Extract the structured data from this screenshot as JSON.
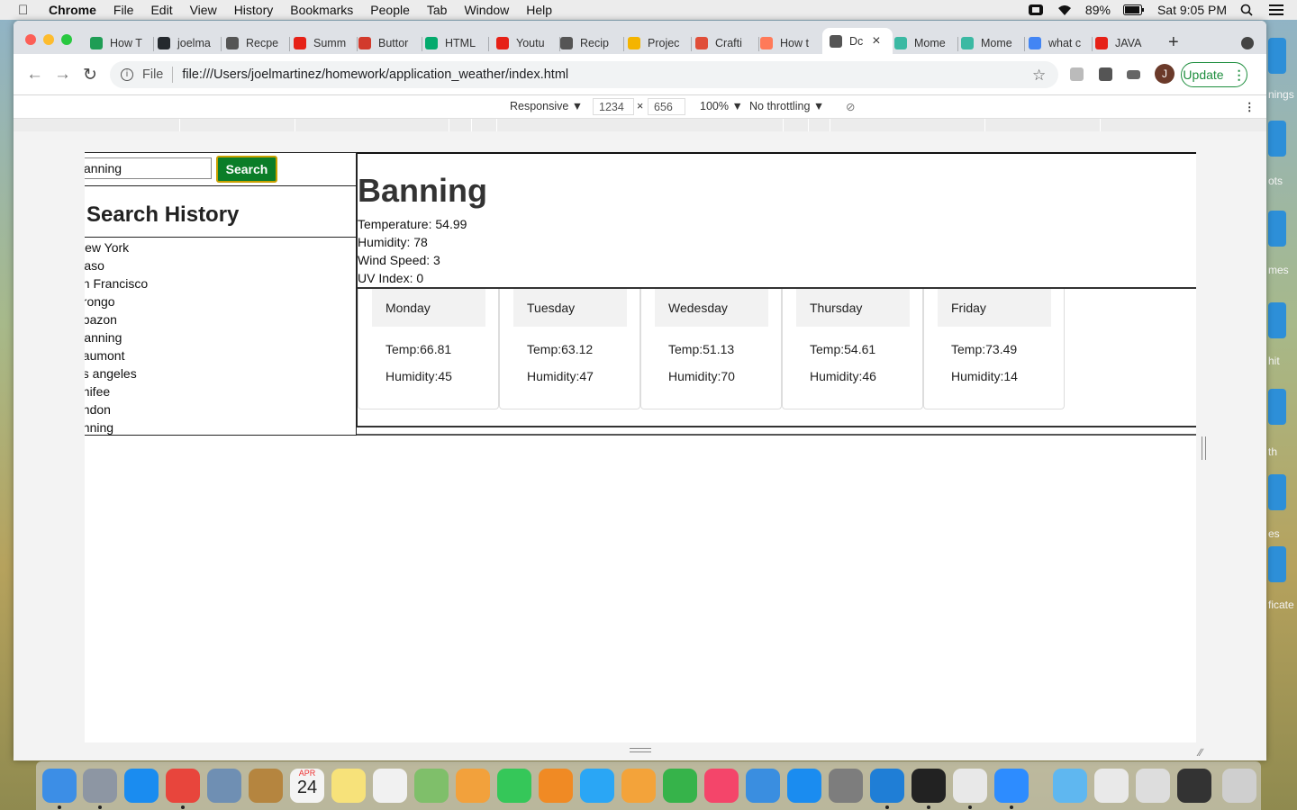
{
  "menubar": {
    "app": "Chrome",
    "items": [
      "File",
      "Edit",
      "View",
      "History",
      "Bookmarks",
      "People",
      "Tab",
      "Window",
      "Help"
    ],
    "battery": "89%",
    "clock": "Sat 9:05 PM"
  },
  "tabs": [
    {
      "label": "How T",
      "color": "#1f9d55"
    },
    {
      "label": "joelma",
      "color": "#24292e"
    },
    {
      "label": "Recpe",
      "color": "#555555"
    },
    {
      "label": "Summ",
      "color": "#e62117"
    },
    {
      "label": "Buttor",
      "color": "#d23a2c"
    },
    {
      "label": "HTML",
      "color": "#04aa6d"
    },
    {
      "label": "Youtu",
      "color": "#e62117"
    },
    {
      "label": "Recip",
      "color": "#555555"
    },
    {
      "label": "Projec",
      "color": "#f4b400"
    },
    {
      "label": "Crafti",
      "color": "#e04e39"
    },
    {
      "label": "How t",
      "color": "#ff7a59"
    },
    {
      "label": "Dc",
      "color": "#555555",
      "active": true
    },
    {
      "label": "Mome",
      "color": "#3bb9a3"
    },
    {
      "label": "Mome",
      "color": "#3bb9a3"
    },
    {
      "label": "what c",
      "color": "#4285f4"
    },
    {
      "label": "JAVA",
      "color": "#e62117"
    }
  ],
  "omnibox": {
    "scheme": "File",
    "url": "file:///Users/joelmartinez/homework/application_weather/index.html"
  },
  "profile_initial": "J",
  "update_label": "Update",
  "devtools": {
    "device": "Responsive ▼",
    "width": "1234",
    "times": "×",
    "height": "656",
    "zoom": "100% ▼",
    "throttling": "No throttling ▼"
  },
  "page": {
    "search_value": "anning",
    "search_button": "Search",
    "history_title": "Search History",
    "history": [
      "New York",
      " Paso",
      "an Francisco",
      "orongo",
      "abazon",
      "Banning",
      "eaumont",
      "os angeles",
      "enifee",
      "ondon",
      "anning"
    ],
    "city": "Banning",
    "temperature": "Temperature: 54.99",
    "humidity": "Humidity: 78",
    "wind": "Wind Speed: 3",
    "uv": "UV Index: 0",
    "forecast": [
      {
        "day": "Monday",
        "temp": "Temp:66.81",
        "humidity": "Humidity:45"
      },
      {
        "day": "Tuesday",
        "temp": "Temp:63.12",
        "humidity": "Humidity:47"
      },
      {
        "day": "Wedesday",
        "temp": "Temp:51.13",
        "humidity": "Humidity:70"
      },
      {
        "day": "Thursday",
        "temp": "Temp:54.61",
        "humidity": "Humidity:46"
      },
      {
        "day": "Friday",
        "temp": "Temp:73.49",
        "humidity": "Humidity:14"
      }
    ]
  },
  "desktop_labels": [
    "nings",
    "ots",
    "mes",
    "hit",
    "th",
    "es",
    "ficate"
  ],
  "dock": [
    {
      "name": "finder-icon",
      "color": "#3c8ee6"
    },
    {
      "name": "launchpad-icon",
      "color": "#8d96a3"
    },
    {
      "name": "safari-icon",
      "color": "#1a8cf0"
    },
    {
      "name": "chrome-icon",
      "color": "#e8453c"
    },
    {
      "name": "preview-icon",
      "color": "#6f8fb3"
    },
    {
      "name": "contacts-icon",
      "color": "#b5853f"
    },
    {
      "name": "calendar-icon",
      "color": "#f4f4f4"
    },
    {
      "name": "notes-icon",
      "color": "#f7e27a"
    },
    {
      "name": "reminders-icon",
      "color": "#f1f1f1"
    },
    {
      "name": "maps-icon",
      "color": "#7fbf6a"
    },
    {
      "name": "photos-icon",
      "color": "#f2a13c"
    },
    {
      "name": "facetime-icon",
      "color": "#35c759"
    },
    {
      "name": "books-icon",
      "color": "#f08a24"
    },
    {
      "name": "messages-icon",
      "color": "#2aa6f5"
    },
    {
      "name": "pages-icon",
      "color": "#f3a33a"
    },
    {
      "name": "numbers-icon",
      "color": "#36b34a"
    },
    {
      "name": "music-icon",
      "color": "#f4456a"
    },
    {
      "name": "keynote-icon",
      "color": "#3a8ee0"
    },
    {
      "name": "app-store-icon",
      "color": "#1a8cf0"
    },
    {
      "name": "system-preferences-icon",
      "color": "#7d7d7d"
    },
    {
      "name": "vscode-icon",
      "color": "#1f7ed6"
    },
    {
      "name": "terminal-icon",
      "color": "#222222"
    },
    {
      "name": "slack-icon",
      "color": "#e8e8e8"
    },
    {
      "name": "zoom-icon",
      "color": "#2d8cff"
    },
    {
      "name": "folder-icon",
      "color": "#5fb7f0"
    },
    {
      "name": "downloads-stack-icon",
      "color": "#e9e9e9"
    },
    {
      "name": "documents-stack-icon",
      "color": "#dddddd"
    },
    {
      "name": "screenshot-stack-icon",
      "color": "#333333"
    },
    {
      "name": "trash-icon",
      "color": "#cfcfcf"
    }
  ],
  "calendar_icon": {
    "month": "APR",
    "day": "24"
  }
}
